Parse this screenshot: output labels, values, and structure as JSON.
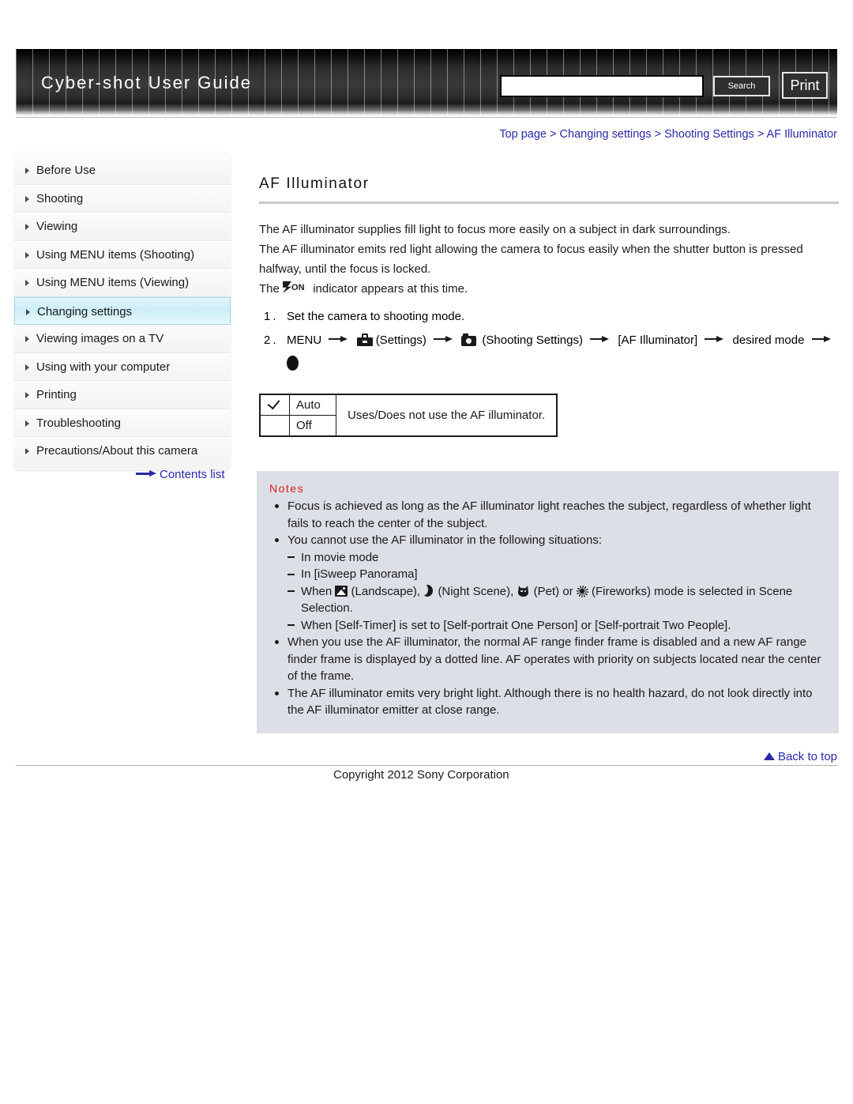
{
  "header": {
    "site_title": "Cyber-shot User Guide",
    "search_value": "",
    "search_placeholder": "",
    "search_button": "Search",
    "print_button": "Print"
  },
  "breadcrumb": {
    "items": [
      "Top page",
      "Changing settings",
      "Shooting Settings",
      "AF Illuminator"
    ],
    "separator": ">"
  },
  "sidebar": {
    "items": [
      {
        "label": "Before Use",
        "active": false
      },
      {
        "label": "Shooting",
        "active": false
      },
      {
        "label": "Viewing",
        "active": false
      },
      {
        "label": "Using MENU items (Shooting)",
        "active": false
      },
      {
        "label": "Using MENU items (Viewing)",
        "active": false
      },
      {
        "label": "Changing settings",
        "active": true
      },
      {
        "label": "Viewing images on a TV",
        "active": false
      },
      {
        "label": "Using with your computer",
        "active": false
      },
      {
        "label": "Printing",
        "active": false
      },
      {
        "label": "Troubleshooting",
        "active": false
      },
      {
        "label": "Precautions/About this camera",
        "active": false
      }
    ],
    "contents_link": "Contents list"
  },
  "main": {
    "title": "AF Illuminator",
    "paragraph_1": "The AF illuminator supplies fill light to focus more easily on a subject in dark surroundings.",
    "paragraph_2": "The AF illuminator emits red light allowing the camera to focus easily when the shutter button is pressed halfway, until the focus is locked.",
    "indicator_prefix": "The",
    "indicator_icon_label": "ON",
    "indicator_suffix": "indicator appears at this time.",
    "steps": [
      {
        "num": "1.",
        "text": "Set the camera to shooting mode."
      }
    ],
    "step2": {
      "num": "2.",
      "menu": "MENU",
      "settings_label": "(Settings)",
      "shooting_settings_label": "(Shooting Settings)",
      "af_bracket": "[AF Illuminator]",
      "desired_mode": "desired mode"
    },
    "table": {
      "rows": [
        {
          "checked": true,
          "option": "Auto"
        },
        {
          "checked": false,
          "option": "Off"
        }
      ],
      "description": "Uses/Does not use the AF illuminator."
    }
  },
  "notes": {
    "title": "Notes",
    "items": [
      {
        "text": "Focus is achieved as long as the AF illuminator light reaches the subject, regardless of whether light fails to reach the center of the subject."
      },
      {
        "text": "You cannot use the AF illuminator in the following situations:",
        "sub": [
          {
            "text": "In movie mode"
          },
          {
            "text": "In [iSweep Panorama]"
          },
          {
            "rich": true,
            "parts": [
              {
                "t": "text",
                "v": "When "
              },
              {
                "t": "icon",
                "v": "landscape-icon"
              },
              {
                "t": "text",
                "v": " (Landscape), "
              },
              {
                "t": "icon",
                "v": "night-scene-icon"
              },
              {
                "t": "text",
                "v": " (Night Scene), "
              },
              {
                "t": "icon",
                "v": "pet-icon"
              },
              {
                "t": "text",
                "v": " (Pet) or "
              },
              {
                "t": "icon",
                "v": "fireworks-icon"
              },
              {
                "t": "text",
                "v": " (Fireworks) mode is selected in Scene Selection."
              }
            ]
          },
          {
            "text": "When [Self-Timer] is set to [Self-portrait One Person] or [Self-portrait Two People]."
          }
        ]
      },
      {
        "text": "When you use the AF illuminator, the normal AF range finder frame is disabled and a new AF range finder frame is displayed by a dotted line. AF operates with priority on subjects located near the center of the frame."
      },
      {
        "text": "The AF illuminator emits very bright light. Although there is no health hazard, do not look directly into the AF illuminator emitter at close range."
      }
    ],
    "inline_labels": {
      "landscape": "(Landscape),",
      "night_scene": "(Night Scene),",
      "pet": "(Pet) or",
      "fireworks": "(Fireworks) mode is selected in Scene Selection.",
      "when": "When"
    }
  },
  "footer": {
    "back_to_top": "Back to top",
    "copyright": "Copyright 2012 Sony Corporation"
  },
  "colors": {
    "link": "#2a2aa8",
    "notes_title": "#e21d1d",
    "notes_bg": "#dcdfe6",
    "active_nav": "#cdeef7"
  }
}
